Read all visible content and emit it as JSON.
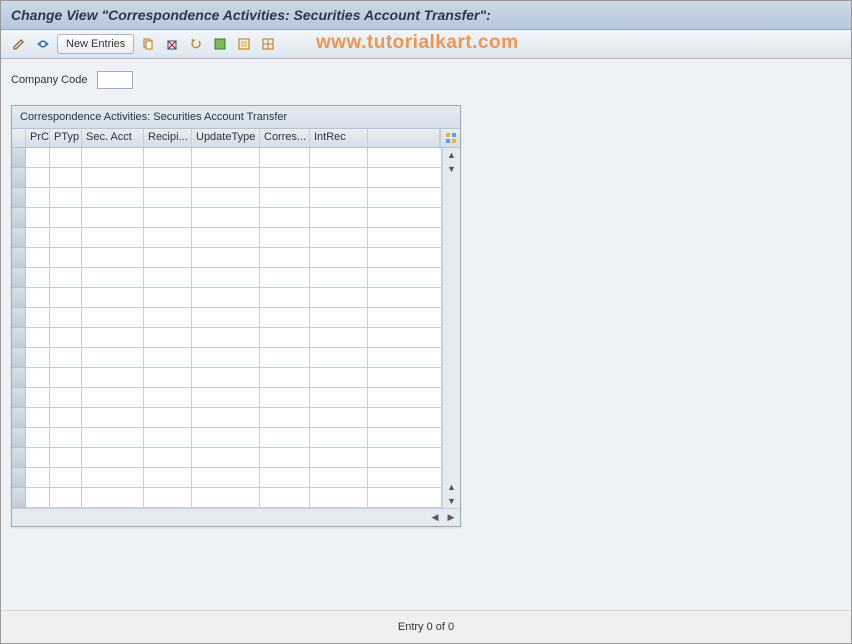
{
  "header": {
    "title": "Change View \"Correspondence Activities: Securities Account Transfer\":"
  },
  "toolbar": {
    "new_entries_label": "New Entries"
  },
  "watermark": "www.tutorialkart.com",
  "form": {
    "company_code_label": "Company Code",
    "company_code_value": ""
  },
  "table": {
    "title": "Correspondence Activities: Securities Account Transfer",
    "columns": {
      "prc": "PrC",
      "ptyp": "PTyp",
      "sec_acct": "Sec. Acct",
      "recipi": "Recipi...",
      "update_type": "UpdateType",
      "corres": "Corres...",
      "intrec": "IntRec"
    },
    "rows": []
  },
  "status": {
    "entry_text": "Entry 0 of 0"
  }
}
